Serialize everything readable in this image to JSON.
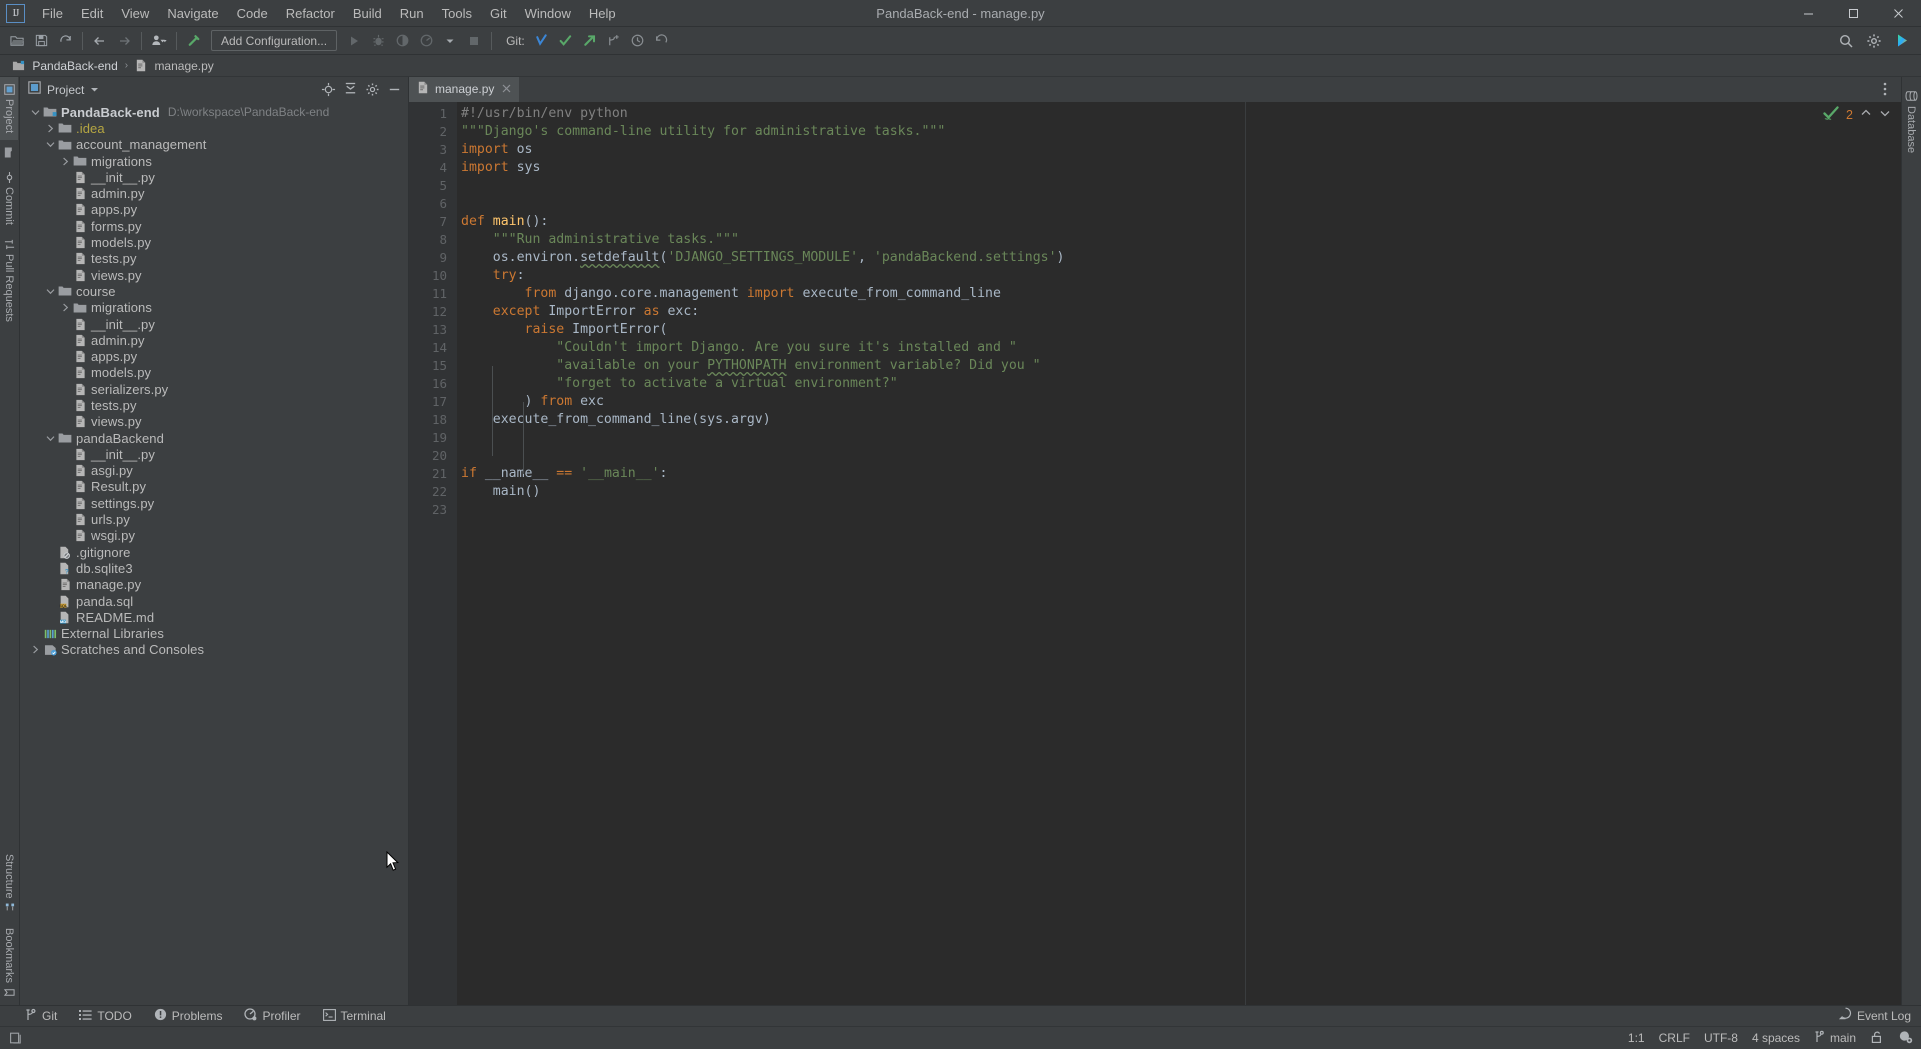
{
  "window": {
    "title": "PandaBack-end - manage.py",
    "logo_text": "IJ",
    "minimize": "─",
    "maximize": "❐",
    "close": "✕"
  },
  "menubar": {
    "items": [
      {
        "label": "File"
      },
      {
        "label": "Edit"
      },
      {
        "label": "View"
      },
      {
        "label": "Navigate"
      },
      {
        "label": "Code"
      },
      {
        "label": "Refactor"
      },
      {
        "label": "Build"
      },
      {
        "label": "Run"
      },
      {
        "label": "Tools"
      },
      {
        "label": "Git"
      },
      {
        "label": "Window"
      },
      {
        "label": "Help"
      }
    ]
  },
  "toolbar": {
    "open_icon": "folder-open-icon",
    "save_icon": "save-icon",
    "sync_icon": "refresh-icon",
    "back_icon": "arrow-left-icon",
    "forward_icon": "arrow-right-icon",
    "profile_icon": "user-profile-icon",
    "build_icon": "hammer-icon",
    "run_config_label": "Add Configuration...",
    "run_icon": "run-play-icon",
    "debug_icon": "debug-bug-icon",
    "coverage_icon": "coverage-icon",
    "profile_run_icon": "profile-run-icon",
    "stop_icon": "stop-square-icon",
    "git_label": "Git:",
    "git_update_icon": "update-project-icon",
    "git_commit_icon": "commit-checkmark-icon",
    "git_push_icon": "push-arrow-icon",
    "git_branch_icon": "new-branch-icon",
    "git_history_icon": "history-clock-icon",
    "git_rollback_icon": "rollback-icon",
    "search_icon": "search-icon",
    "settings_icon": "gear-icon",
    "ide_help_icon": "ide-assistant-icon"
  },
  "navbar": {
    "crumbs": [
      {
        "label": "PandaBack-end",
        "icon": "project-folder-icon"
      },
      {
        "label": "manage.py",
        "icon": "python-file-icon"
      }
    ],
    "separator": "›"
  },
  "left_stripe": {
    "top_items": [
      {
        "label": "Project",
        "icon": "project-icon",
        "active": true
      },
      {
        "label": "",
        "icon": "folder-icon",
        "active": false
      },
      {
        "label": "Commit",
        "icon": "commit-icon",
        "active": false
      },
      {
        "label": "Pull Requests",
        "icon": "pull-request-icon",
        "active": false
      }
    ],
    "bottom_items": [
      {
        "label": "Structure",
        "icon": "structure-icon"
      },
      {
        "label": "Bookmarks",
        "icon": "bookmarks-icon"
      }
    ]
  },
  "right_stripe": {
    "items": [
      {
        "label": "Database",
        "icon": "database-icon"
      }
    ]
  },
  "project_panel": {
    "title": "Project",
    "dropdown_icon": "chevron-down-icon",
    "locate_icon": "locate-target-icon",
    "collapse_icon": "collapse-all-icon",
    "settings_icon": "gear-icon",
    "hide_icon": "minimize-icon",
    "tree": [
      {
        "depth": 0,
        "twist": "open",
        "icon": "project-root-icon",
        "label": "PandaBack-end",
        "bold": true,
        "path": "D:\\workspace\\PandaBack-end"
      },
      {
        "depth": 1,
        "twist": "closed",
        "icon": "folder-icon",
        "label": ".idea",
        "excluded": true
      },
      {
        "depth": 1,
        "twist": "open",
        "icon": "folder-icon",
        "label": "account_management"
      },
      {
        "depth": 2,
        "twist": "closed",
        "icon": "folder-icon",
        "label": "migrations"
      },
      {
        "depth": 2,
        "twist": "none",
        "icon": "python-file-icon",
        "label": "__init__.py"
      },
      {
        "depth": 2,
        "twist": "none",
        "icon": "python-file-icon",
        "label": "admin.py"
      },
      {
        "depth": 2,
        "twist": "none",
        "icon": "python-file-icon",
        "label": "apps.py"
      },
      {
        "depth": 2,
        "twist": "none",
        "icon": "python-file-icon",
        "label": "forms.py"
      },
      {
        "depth": 2,
        "twist": "none",
        "icon": "python-file-icon",
        "label": "models.py"
      },
      {
        "depth": 2,
        "twist": "none",
        "icon": "python-file-icon",
        "label": "tests.py"
      },
      {
        "depth": 2,
        "twist": "none",
        "icon": "python-file-icon",
        "label": "views.py"
      },
      {
        "depth": 1,
        "twist": "open",
        "icon": "folder-icon",
        "label": "course"
      },
      {
        "depth": 2,
        "twist": "closed",
        "icon": "folder-icon",
        "label": "migrations"
      },
      {
        "depth": 2,
        "twist": "none",
        "icon": "python-file-icon",
        "label": "__init__.py"
      },
      {
        "depth": 2,
        "twist": "none",
        "icon": "python-file-icon",
        "label": "admin.py"
      },
      {
        "depth": 2,
        "twist": "none",
        "icon": "python-file-icon",
        "label": "apps.py"
      },
      {
        "depth": 2,
        "twist": "none",
        "icon": "python-file-icon",
        "label": "models.py"
      },
      {
        "depth": 2,
        "twist": "none",
        "icon": "python-file-icon",
        "label": "serializers.py"
      },
      {
        "depth": 2,
        "twist": "none",
        "icon": "python-file-icon",
        "label": "tests.py"
      },
      {
        "depth": 2,
        "twist": "none",
        "icon": "python-file-icon",
        "label": "views.py"
      },
      {
        "depth": 1,
        "twist": "open",
        "icon": "folder-icon",
        "label": "pandaBackend"
      },
      {
        "depth": 2,
        "twist": "none",
        "icon": "python-file-icon",
        "label": "__init__.py"
      },
      {
        "depth": 2,
        "twist": "none",
        "icon": "python-file-icon",
        "label": "asgi.py"
      },
      {
        "depth": 2,
        "twist": "none",
        "icon": "python-file-icon",
        "label": "Result.py"
      },
      {
        "depth": 2,
        "twist": "none",
        "icon": "python-file-icon",
        "label": "settings.py"
      },
      {
        "depth": 2,
        "twist": "none",
        "icon": "python-file-icon",
        "label": "urls.py"
      },
      {
        "depth": 2,
        "twist": "none",
        "icon": "python-file-icon",
        "label": "wsgi.py"
      },
      {
        "depth": 1,
        "twist": "none",
        "icon": "gitignore-file-icon",
        "label": ".gitignore"
      },
      {
        "depth": 1,
        "twist": "none",
        "icon": "unknown-file-icon",
        "label": "db.sqlite3"
      },
      {
        "depth": 1,
        "twist": "none",
        "icon": "python-file-icon",
        "label": "manage.py"
      },
      {
        "depth": 1,
        "twist": "none",
        "icon": "sql-file-icon",
        "label": "panda.sql"
      },
      {
        "depth": 1,
        "twist": "none",
        "icon": "markdown-file-icon",
        "label": "README.md"
      },
      {
        "depth": 0,
        "twist": "none",
        "icon": "external-libraries-icon",
        "label": "External Libraries"
      },
      {
        "depth": 0,
        "twist": "closed",
        "icon": "scratches-icon",
        "label": "Scratches and Consoles"
      }
    ]
  },
  "editor": {
    "tabs": [
      {
        "label": "manage.py",
        "icon": "python-file-icon",
        "close_icon": "close-icon",
        "active": true
      }
    ],
    "options_icon": "more-vertical-icon",
    "inspection": {
      "status_icon": "inspection-ok-icon",
      "count": "2",
      "prev_icon": "chevron-up-icon",
      "next_icon": "chevron-down-icon"
    },
    "lines": [
      {
        "n": 1,
        "run_marker": true,
        "tokens": [
          {
            "t": "#!/usr/bin/env python",
            "c": "cm"
          }
        ]
      },
      {
        "n": 2,
        "tokens": [
          {
            "t": "\"\"\"Django's command-line utility for administrative tasks.\"\"\"",
            "c": "s"
          }
        ]
      },
      {
        "n": 3,
        "tokens": [
          {
            "t": "import ",
            "c": "k"
          },
          {
            "t": "os",
            "c": "id"
          }
        ]
      },
      {
        "n": 4,
        "tokens": [
          {
            "t": "import ",
            "c": "k"
          },
          {
            "t": "sys",
            "c": "id"
          }
        ]
      },
      {
        "n": 5,
        "tokens": []
      },
      {
        "n": 6,
        "tokens": []
      },
      {
        "n": 7,
        "tokens": [
          {
            "t": "def ",
            "c": "k"
          },
          {
            "t": "main",
            "c": "fn"
          },
          {
            "t": "():",
            "c": "id"
          }
        ]
      },
      {
        "n": 8,
        "tokens": [
          {
            "t": "    \"\"\"Run administrative tasks.\"\"\"",
            "c": "s"
          }
        ]
      },
      {
        "n": 9,
        "tokens": [
          {
            "t": "    os.environ.",
            "c": "id"
          },
          {
            "t": "setdefault",
            "c": "id wiggle"
          },
          {
            "t": "(",
            "c": "id"
          },
          {
            "t": "'DJANGO_SETTINGS_MODULE'",
            "c": "s"
          },
          {
            "t": ", ",
            "c": "id"
          },
          {
            "t": "'pandaBackend.settings'",
            "c": "s"
          },
          {
            "t": ")",
            "c": "id"
          }
        ]
      },
      {
        "n": 10,
        "tokens": [
          {
            "t": "    ",
            "c": "id"
          },
          {
            "t": "try",
            "c": "k"
          },
          {
            "t": ":",
            "c": "id"
          }
        ]
      },
      {
        "n": 11,
        "tokens": [
          {
            "t": "        ",
            "c": "id"
          },
          {
            "t": "from ",
            "c": "k"
          },
          {
            "t": "django.core.management ",
            "c": "id"
          },
          {
            "t": "import ",
            "c": "k"
          },
          {
            "t": "execute_from_command_line",
            "c": "id"
          }
        ]
      },
      {
        "n": 12,
        "tokens": [
          {
            "t": "    ",
            "c": "id"
          },
          {
            "t": "except ",
            "c": "k"
          },
          {
            "t": "ImportError ",
            "c": "cls"
          },
          {
            "t": "as ",
            "c": "k"
          },
          {
            "t": "exc:",
            "c": "id"
          }
        ]
      },
      {
        "n": 13,
        "tokens": [
          {
            "t": "        ",
            "c": "id"
          },
          {
            "t": "raise ",
            "c": "k"
          },
          {
            "t": "ImportError(",
            "c": "cls"
          }
        ]
      },
      {
        "n": 14,
        "tokens": [
          {
            "t": "            \"Couldn't import Django. Are you sure it's installed and \"",
            "c": "s"
          }
        ]
      },
      {
        "n": 15,
        "tokens": [
          {
            "t": "            \"available on your ",
            "c": "s"
          },
          {
            "t": "PYTHONPATH",
            "c": "s wiggle"
          },
          {
            "t": " environment variable? Did you \"",
            "c": "s"
          }
        ]
      },
      {
        "n": 16,
        "tokens": [
          {
            "t": "            \"forget to activate a virtual environment?\"",
            "c": "s"
          }
        ]
      },
      {
        "n": 17,
        "tokens": [
          {
            "t": "        ) ",
            "c": "id"
          },
          {
            "t": "from ",
            "c": "k"
          },
          {
            "t": "exc",
            "c": "id"
          }
        ]
      },
      {
        "n": 18,
        "tokens": [
          {
            "t": "    execute_from_command_line(sys.argv)",
            "c": "id"
          }
        ]
      },
      {
        "n": 19,
        "tokens": []
      },
      {
        "n": 20,
        "tokens": []
      },
      {
        "n": 21,
        "tokens": [
          {
            "t": "if ",
            "c": "k"
          },
          {
            "t": "__name__ ",
            "c": "id"
          },
          {
            "t": "== ",
            "c": "k"
          },
          {
            "t": "'__main__'",
            "c": "s"
          },
          {
            "t": ":",
            "c": "id"
          }
        ]
      },
      {
        "n": 22,
        "tokens": [
          {
            "t": "    main()",
            "c": "id"
          }
        ]
      },
      {
        "n": 23,
        "tokens": []
      }
    ]
  },
  "tool_window_bar": {
    "items": [
      {
        "label": "Git",
        "icon": "git-branch-icon"
      },
      {
        "label": "TODO",
        "icon": "todo-list-icon"
      },
      {
        "label": "Problems",
        "icon": "problems-warning-icon"
      },
      {
        "label": "Profiler",
        "icon": "profiler-icon"
      },
      {
        "label": "Terminal",
        "icon": "terminal-icon"
      }
    ],
    "event_log": {
      "label": "Event Log",
      "icon": "event-log-icon"
    }
  },
  "status_bar": {
    "layout_icon": "layout-toggle-icon",
    "caret_position": "1:1",
    "line_separator": "CRLF",
    "encoding": "UTF-8",
    "indent": "4 spaces",
    "branch": "main",
    "branch_icon": "git-branch-icon",
    "lock_icon": "unlock-icon",
    "inspection_icon": "inspection-profile-icon"
  },
  "colors": {
    "bg_panel": "#3c3f41",
    "bg_editor": "#2b2b2b",
    "bg_gutter": "#313335",
    "text": "#bbbbbb",
    "keyword": "#cc7832",
    "string": "#6a8759",
    "comment": "#808080",
    "function": "#ffc66d",
    "identifier": "#a9b7c6",
    "accent_green": "#59a869",
    "tab_active": "#4e5254"
  }
}
